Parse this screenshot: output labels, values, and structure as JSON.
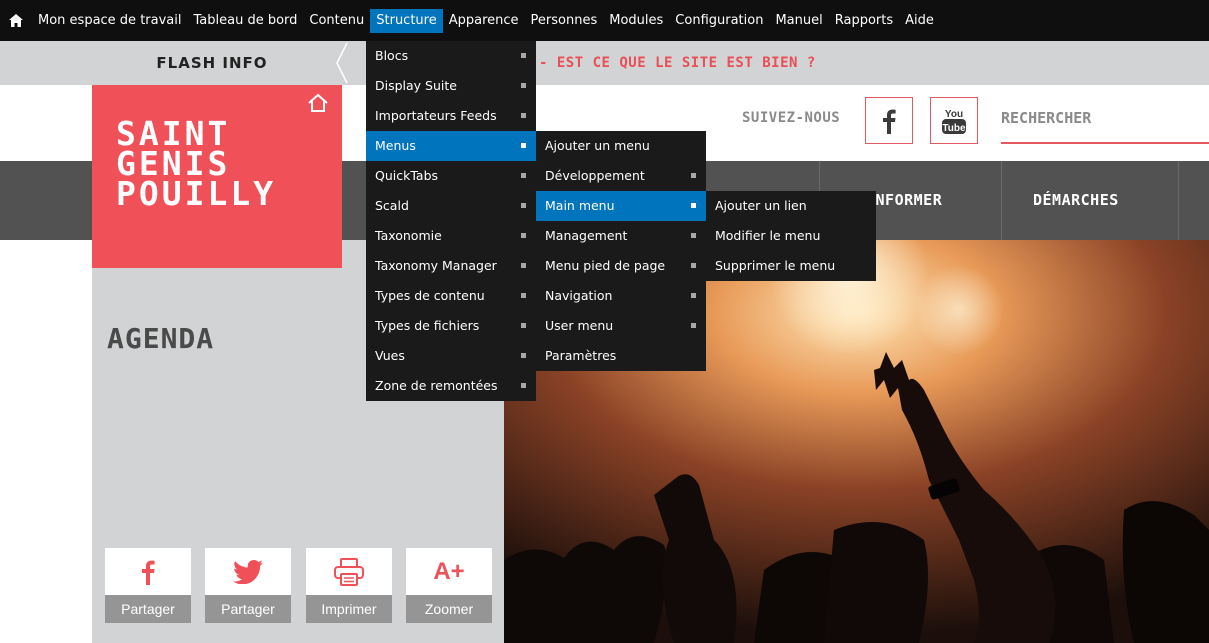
{
  "toolbar": {
    "items": [
      "Mon espace de travail",
      "Tableau de bord",
      "Contenu",
      "Structure",
      "Apparence",
      "Personnes",
      "Modules",
      "Configuration",
      "Manuel",
      "Rapports",
      "Aide"
    ],
    "active": "Structure"
  },
  "structure_menu": {
    "items": [
      "Blocs",
      "Display Suite",
      "Importateurs Feeds",
      "Menus",
      "QuickTabs",
      "Scald",
      "Taxonomie",
      "Taxonomy Manager",
      "Types de contenu",
      "Types de fichiers",
      "Vues",
      "Zone de remontées"
    ],
    "active": "Menus"
  },
  "menus_submenu": {
    "items": [
      "Ajouter un menu",
      "Développement",
      "Main menu",
      "Management",
      "Menu pied de page",
      "Navigation",
      "User menu",
      "Paramètres"
    ],
    "active": "Main menu"
  },
  "main_menu_submenu": {
    "items": [
      "Ajouter un lien",
      "Modifier le menu",
      "Supprimer le menu"
    ]
  },
  "flash": {
    "label": "FLASH INFO",
    "text": "- EST CE QUE LE SITE EST BIEN ?"
  },
  "logo": {
    "lines": [
      "SAINT",
      "GENIS",
      "POUILLY"
    ]
  },
  "header": {
    "follow_label": "SUIVEZ-NOUS",
    "search_label": "RECHERCHER",
    "youtube_top": "You",
    "youtube_bottom": "Tube"
  },
  "nav": {
    "items": [
      "INFORMER",
      "DÉMARCHES"
    ]
  },
  "page": {
    "title": "AGENDA"
  },
  "share": {
    "facebook": "Partager",
    "twitter": "Partager",
    "print": "Imprimer",
    "zoom": "Zoomer",
    "zoom_icon": "A+"
  },
  "colors": {
    "brand_red": "#f05159",
    "admin_active": "#0074bd",
    "toolbar_bg": "#0f0f0f",
    "nav_bg": "#525252",
    "panel_grey": "#d1d3d4"
  }
}
